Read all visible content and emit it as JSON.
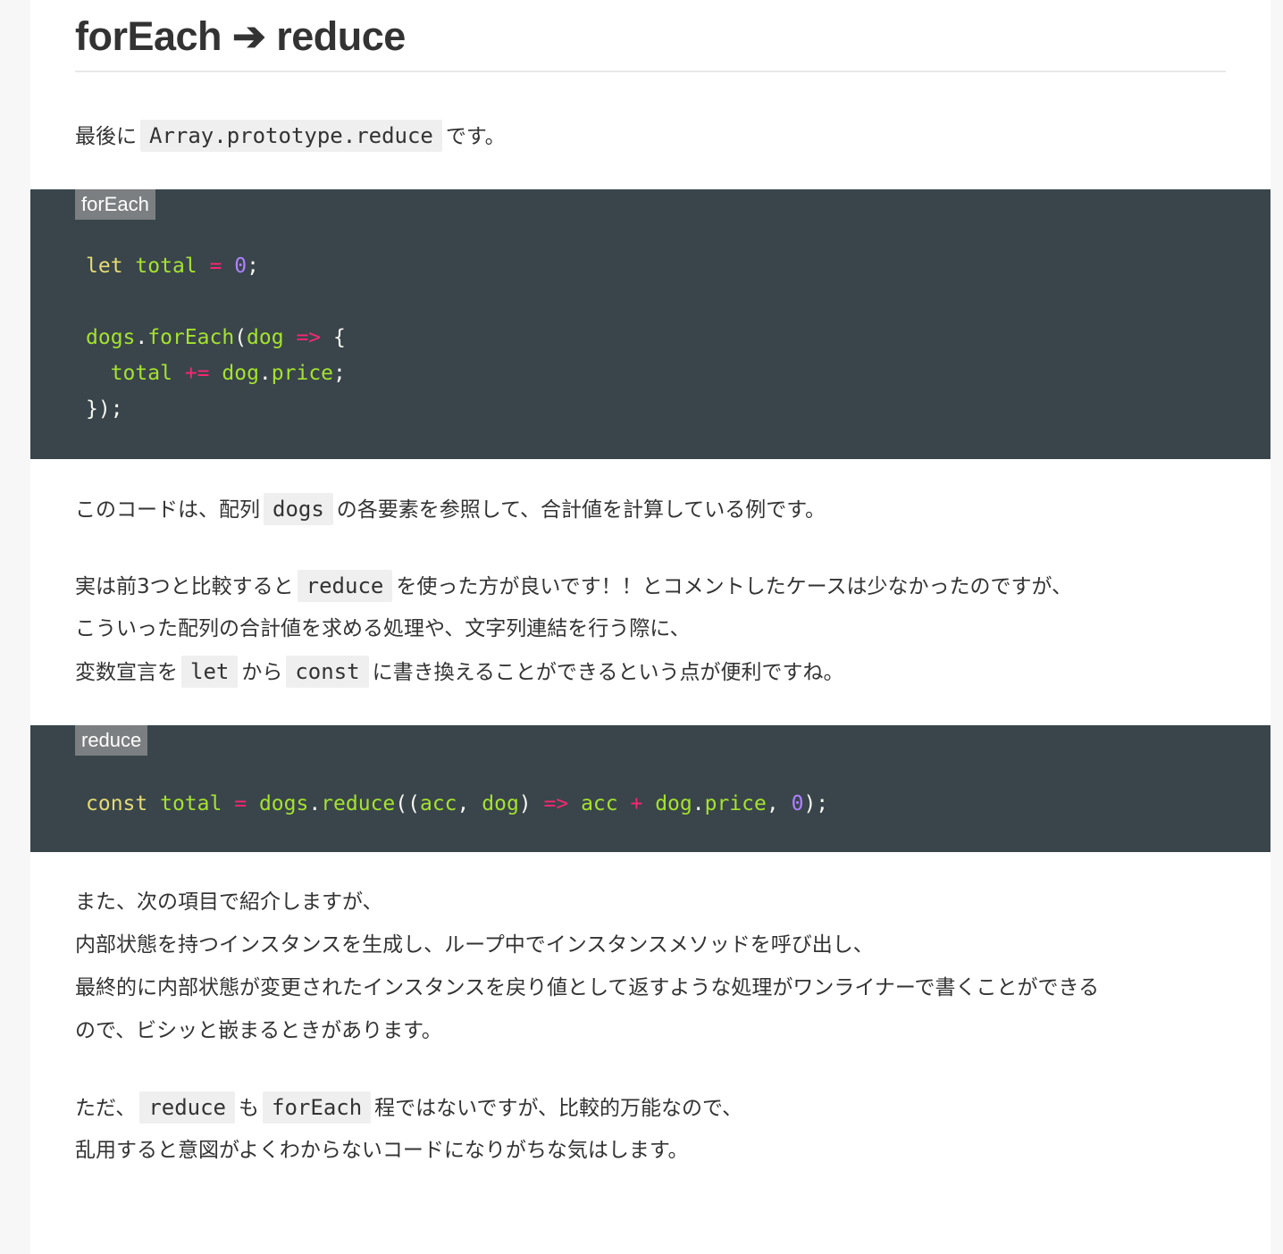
{
  "heading": "forEach ➔ reduce",
  "intro": {
    "before": "最後に",
    "code": "Array.prototype.reduce",
    "after": "です。"
  },
  "foreach_block": {
    "label": "forEach",
    "code": {
      "l1_kw": "let",
      "l1_total": "total",
      "l1_eq": "=",
      "l1_zero": "0",
      "l1_semi": ";",
      "l3_dogs": "dogs",
      "l3_dot": ".",
      "l3_forEach": "forEach",
      "l3_paren": "(",
      "l3_dog": "dog",
      "l3_arrow": "=>",
      "l3_brace": "{",
      "l4_total": "total",
      "l4_op": "+=",
      "l4_dog": "dog",
      "l4_dot": ".",
      "l4_price": "price",
      "l4_semi": ";",
      "l5_close": "});"
    }
  },
  "para1": {
    "before": "このコードは、配列",
    "code": "dogs",
    "after": "の各要素を参照して、合計値を計算している例です。"
  },
  "para2": {
    "l1_before": "実は前3つと比較すると",
    "l1_code": "reduce",
    "l1_after": "を使った方が良いです！！とコメントしたケースは少なかったのですが、",
    "l2": "こういった配列の合計値を求める処理や、文字列連結を行う際に、",
    "l3_before": "変数宣言を",
    "l3_code1": "let",
    "l3_mid": "から",
    "l3_code2": "const",
    "l3_after": "に書き換えることができるという点が便利ですね。"
  },
  "reduce_block": {
    "label": "reduce",
    "code": {
      "kw": "const",
      "total": "total",
      "eq": "=",
      "dogs": "dogs",
      "dot1": ".",
      "reduce": "reduce",
      "open": "((",
      "acc": "acc",
      "comma1": ",",
      "dog": "dog",
      "close1": ")",
      "arrow": "=>",
      "acc2": "acc",
      "plus": "+",
      "dog2": "dog",
      "dot2": ".",
      "price": "price",
      "comma2": ",",
      "zero": "0",
      "close2": ");"
    }
  },
  "para3": {
    "l1": "また、次の項目で紹介しますが、",
    "l2": "内部状態を持つインスタンスを生成し、ループ中でインスタンスメソッドを呼び出し、",
    "l3": "最終的に内部状態が変更されたインスタンスを戻り値として返すような処理がワンライナーで書くことができる",
    "l4": "ので、ビシッと嵌まるときがあります。"
  },
  "para4": {
    "l1_before": "ただ、",
    "l1_code1": "reduce",
    "l1_mid": "も",
    "l1_code2": "forEach",
    "l1_after": "程ではないですが、比較的万能なので、",
    "l2": "乱用すると意図がよくわからないコードになりがちな気はします。"
  },
  "colors": {
    "code_background": "#39454b",
    "label_background": "#7b7f81",
    "keyword": "#e6db74",
    "identifier": "#a6e22e",
    "operator": "#f92672",
    "number": "#ae81ff"
  }
}
